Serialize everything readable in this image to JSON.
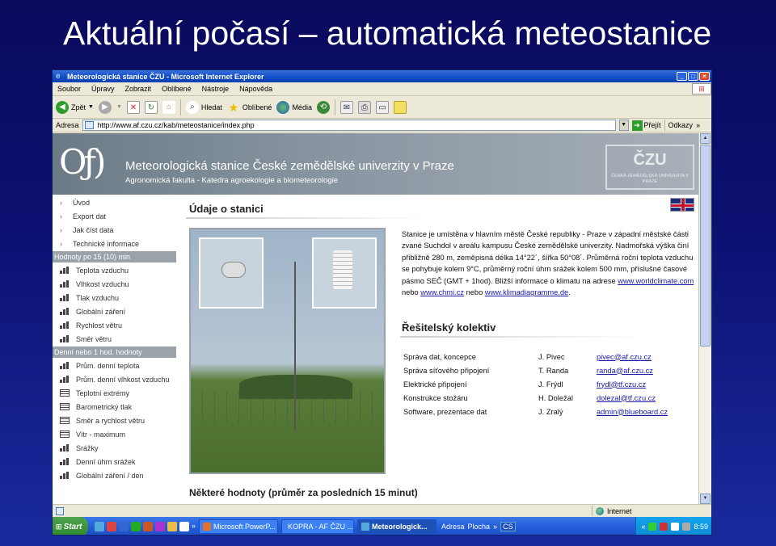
{
  "slide": {
    "title": "Aktuální počasí – automatická meteostanice"
  },
  "browser": {
    "window_title": "Meteorologická stanice ČZU - Microsoft Internet Explorer",
    "menu": [
      "Soubor",
      "Úpravy",
      "Zobrazit",
      "Oblíbené",
      "Nástroje",
      "Nápověda"
    ],
    "toolbar": {
      "back": "Zpět",
      "search": "Hledat",
      "favorites": "Oblíbené",
      "media": "Média"
    },
    "address_label": "Adresa",
    "url": "http://www.af.czu.cz/kab/meteostanice/index.php",
    "go_label": "Přejít",
    "links_label": "Odkazy",
    "status_zone": "Internet"
  },
  "page": {
    "banner_title": "Meteorologická stanice České zemědělské univerzity v Praze",
    "banner_subtitle": "Agronomická fakulta - Katedra agroekologie a biometeorologie",
    "crest_text": "ČZU",
    "crest_small": "ČESKÁ ZEMĚDĚLSKÁ UNIVERZITA V PRAZE",
    "nav_top": [
      "Úvod",
      "Export dat",
      "Jak číst data",
      "Technické informace"
    ],
    "nav_header_1": "Hodnoty po 15 (10) min",
    "nav_group_1": [
      "Teplota vzduchu",
      "Vlhkost vzduchu",
      "Tlak vzduchu",
      "Globální záření",
      "Rychlost větru",
      "Směr větru"
    ],
    "nav_header_2": "Denní nebo 1 hod. hodnoty",
    "nav_group_2_bars": [
      "Prům. denní teplota",
      "Prům. denní vlhkost vzduchu"
    ],
    "nav_group_2_tables": [
      "Teplotní extrémy",
      "Barometrický tlak",
      "Směr a rychlost větru",
      "Vítr - maximum"
    ],
    "nav_group_2_rest": [
      "Srážky",
      "Denní úhrn srážek",
      "Globální záření / den"
    ],
    "heading_station": "Údaje o stanici",
    "description": {
      "text": "Stanice je umístěna v hlavním městě České republiky - Praze v západní městské části zvané Suchdol v areálu kampusu České zemědělské univerzity. Nadmořská výška činí přibližně 280 m, zeměpisná délka 14°22´, šířka 50°08´. Průměrná roční teplota vzduchu se pohybuje kolem 9°C, průměrný roční úhrn srážek kolem 500 mm, příslušné časové pásmo SEČ (GMT + 1hod). Bližší informace o klimatu na adrese ",
      "link1": "www.worldclimate.com",
      "or1": " nebo ",
      "link2": "www.chmi.cz",
      "or2": " nebo ",
      "link3": "www.klimadiagramme.de",
      "end": "."
    },
    "heading_team": "Řešitelský kolektiv",
    "team": [
      {
        "role": "Správa dat, koncepce",
        "name": "J. Pivec",
        "email": "pivec@af.czu.cz"
      },
      {
        "role": "Správa síťového připojení",
        "name": "T. Randa",
        "email": "randa@af.czu.cz"
      },
      {
        "role": "Elektrické připojení",
        "name": "J. Frýdl",
        "email": "frydl@tf.czu.cz"
      },
      {
        "role": "Konstrukce stožáru",
        "name": "H. Doležal",
        "email": "dolezal@tf.czu.cz"
      },
      {
        "role": "Software, prezentace dat",
        "name": "J. Zralý",
        "email": "admin@blueboard.cz"
      }
    ],
    "bottom_heading": "Některé hodnoty (průměr za posledních 15 minut)"
  },
  "taskbar": {
    "start": "Start",
    "tasks": [
      "Microsoft PowerP...",
      "KOPRA - AF ČZU ...",
      "Meteorologick..."
    ],
    "address": "Adresa",
    "desktop": "Plocha",
    "lang": "CS",
    "time": "8:59"
  }
}
